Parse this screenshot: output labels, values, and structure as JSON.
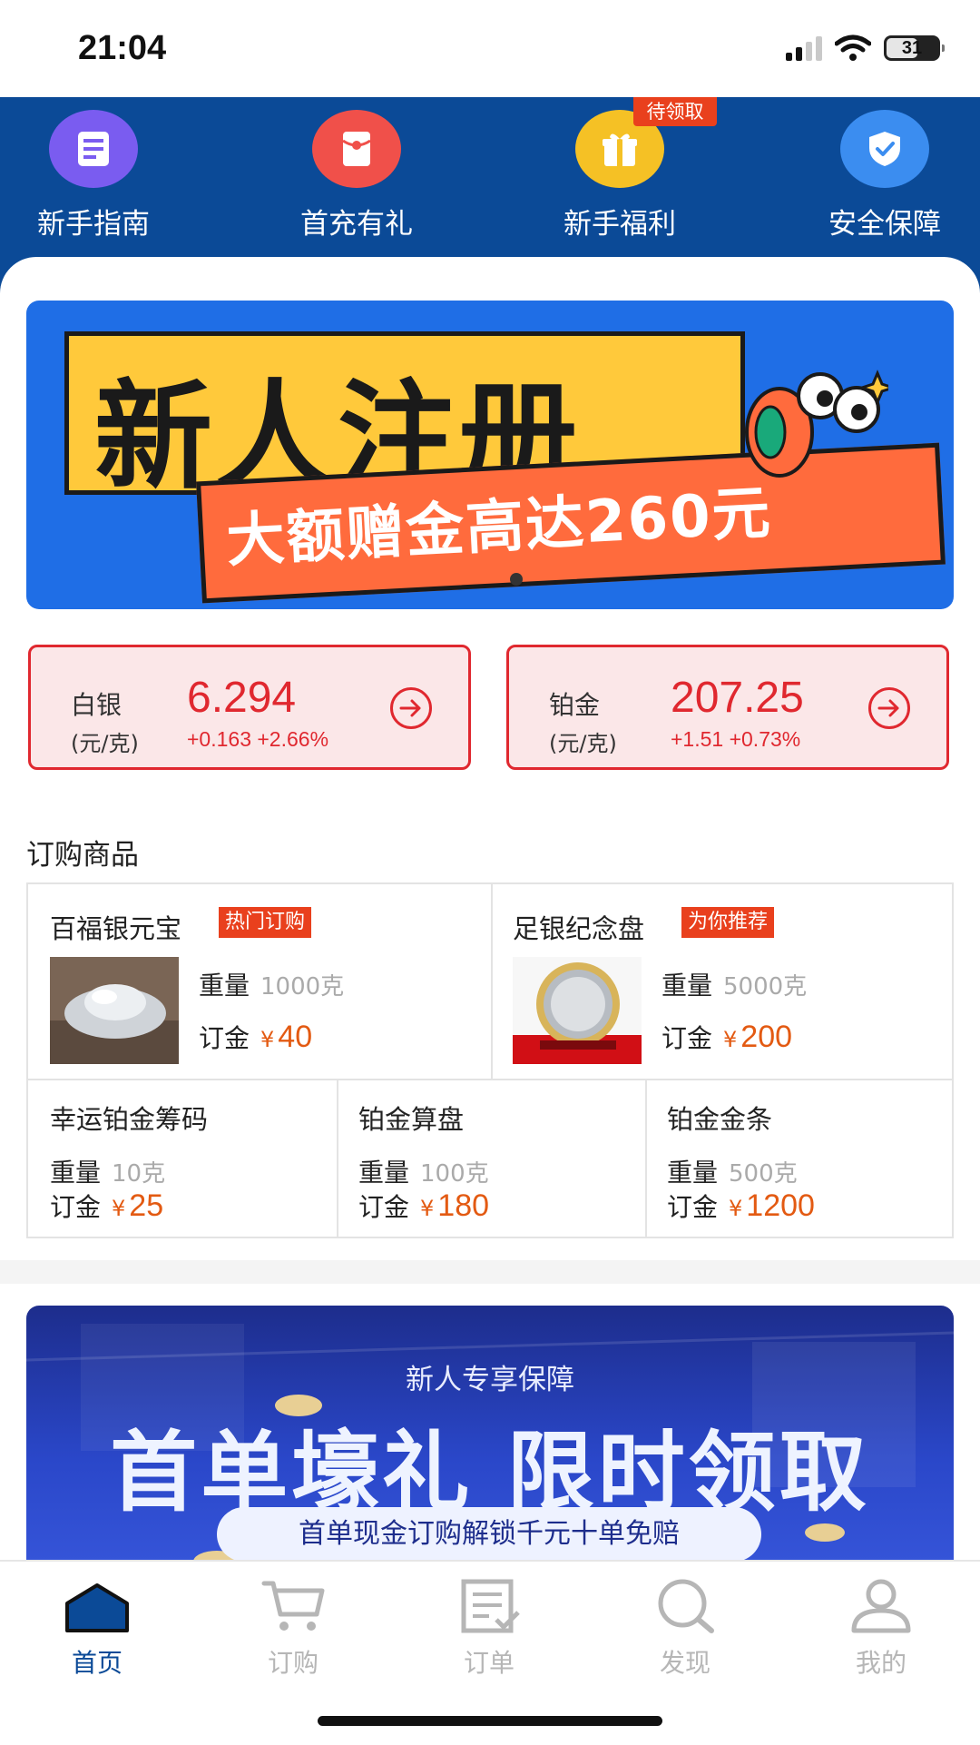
{
  "status_bar": {
    "time": "21:04",
    "battery": "31"
  },
  "top_nav": {
    "items": [
      {
        "label": "新手指南",
        "icon": "guide-icon",
        "color": "#7a5cf0"
      },
      {
        "label": "首充有礼",
        "icon": "red-envelope-icon",
        "color": "#f0504a"
      },
      {
        "label": "新手福利",
        "icon": "gift-icon",
        "color": "#f5c125"
      },
      {
        "label": "安全保障",
        "icon": "shield-icon",
        "color": "#3b8df0"
      }
    ],
    "badge": "待领取"
  },
  "banner_register": {
    "title": "新人注册",
    "subtitle": "大额赠金高达260元"
  },
  "prices": [
    {
      "name": "白银",
      "unit": "(元/克)",
      "value": "6.294",
      "change": "+0.163  +2.66%"
    },
    {
      "name": "铂金",
      "unit": "(元/克)",
      "value": "207.25",
      "change": "+1.51  +0.73%"
    }
  ],
  "products_section": {
    "title": "订购商品",
    "weight_label": "重量",
    "deposit_label": "订金",
    "currency": "¥",
    "featured": [
      {
        "name": "百福银元宝",
        "tag": "热门订购",
        "weight": "1000克",
        "deposit": "40"
      },
      {
        "name": "足银纪念盘",
        "tag": "为你推荐",
        "weight": "5000克",
        "deposit": "200"
      }
    ],
    "items": [
      {
        "name": "幸运铂金筹码",
        "weight": "10克",
        "deposit": "25"
      },
      {
        "name": "铂金算盘",
        "weight": "100克",
        "deposit": "180"
      },
      {
        "name": "铂金金条",
        "weight": "500克",
        "deposit": "1200"
      }
    ]
  },
  "banner_first_order": {
    "subtitle": "新人专享保障",
    "title": "首单壕礼 限时领取",
    "pill": "首单现金订购解锁千元十单免赔"
  },
  "tab_bar": {
    "tabs": [
      {
        "label": "首页",
        "icon": "home-icon",
        "active": true
      },
      {
        "label": "订购",
        "icon": "cart-icon",
        "active": false
      },
      {
        "label": "订单",
        "icon": "order-list-icon",
        "active": false
      },
      {
        "label": "发现",
        "icon": "search-icon",
        "active": false
      },
      {
        "label": "我的",
        "icon": "user-icon",
        "active": false
      }
    ]
  },
  "colors": {
    "brand_blue": "#0b4a97",
    "price_red": "#e0282f",
    "tag_orange": "#e9401d",
    "deposit_orange": "#e35a12"
  }
}
